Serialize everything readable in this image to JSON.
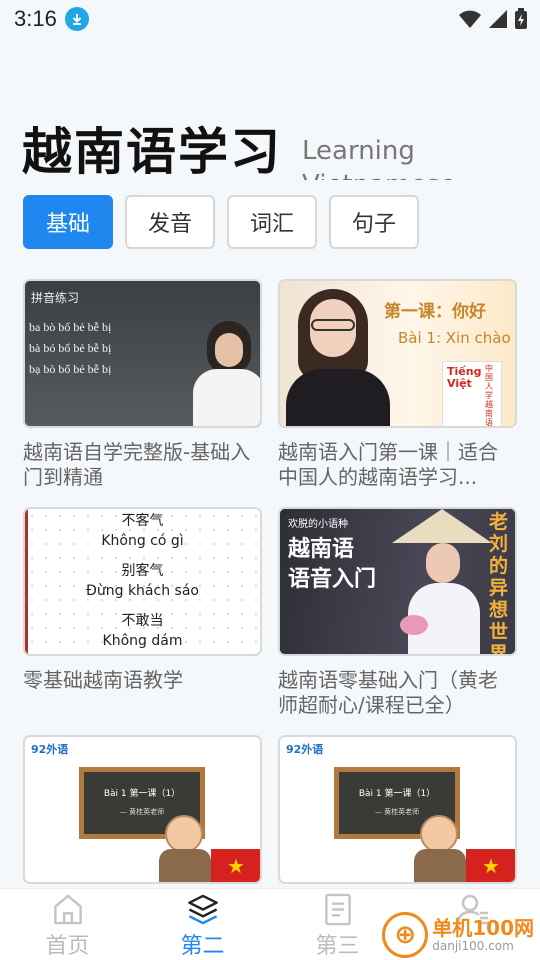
{
  "status": {
    "time": "3:16"
  },
  "header": {
    "title": "越南语学习",
    "subtitle": "Learning Vietnamese"
  },
  "tabs": [
    {
      "label": "基础",
      "active": true
    },
    {
      "label": "发音",
      "active": false
    },
    {
      "label": "词汇",
      "active": false
    },
    {
      "label": "句子",
      "active": false
    }
  ],
  "courses": [
    {
      "title": "越南语自学完整版-基础入门到精通",
      "thumb": {
        "heading": "拼音练习",
        "rows": [
          "ba bò bổ bẻ bễ bị",
          "bà bó bổ bẻ bễ bị",
          "bạ bò bổ bẻ bễ bị"
        ]
      }
    },
    {
      "title": "越南语入门第一课｜适合中国人的越南语学习...",
      "thumb": {
        "heading": "第一课：你好",
        "sub": "Bài 1: Xin chào",
        "book_top": "Tiếng Việt",
        "book_side": "中国人学越南语"
      }
    },
    {
      "title": "零基础越南语教学",
      "thumb": {
        "lines": [
          "不客气",
          "Không có gì",
          "别客气",
          "Đừng khách sáo",
          "不敢当",
          "Không dám"
        ]
      }
    },
    {
      "title": "越南语零基础入门（黄老师超耐心/课程已全）",
      "thumb": {
        "tag": "欢脱的小语种",
        "heading_line1": "越南语",
        "heading_line2": "语音入门",
        "side": "老刘的异想世界"
      }
    },
    {
      "title": "",
      "thumb": {
        "brand": "92外语",
        "board_line1": "Bài 1   第一课（1）",
        "board_line2": "— 黄桂英老师"
      }
    },
    {
      "title": "",
      "thumb": {
        "brand": "92外语",
        "board_line1": "Bài 1   第一课（1）",
        "board_line2": "— 黄桂英老师"
      }
    }
  ],
  "nav": [
    {
      "label": "首页",
      "icon": "home-icon",
      "active": false
    },
    {
      "label": "第二",
      "icon": "layers-icon",
      "active": true
    },
    {
      "label": "第三",
      "icon": "document-icon",
      "active": false
    },
    {
      "label": "",
      "icon": "user-icon",
      "active": false
    }
  ],
  "watermark": {
    "main": "单机100网",
    "url": "danji100.com"
  },
  "colors": {
    "accent": "#1e88f0",
    "download_badge": "#1fa7e8",
    "watermark": "#f08a1c"
  }
}
